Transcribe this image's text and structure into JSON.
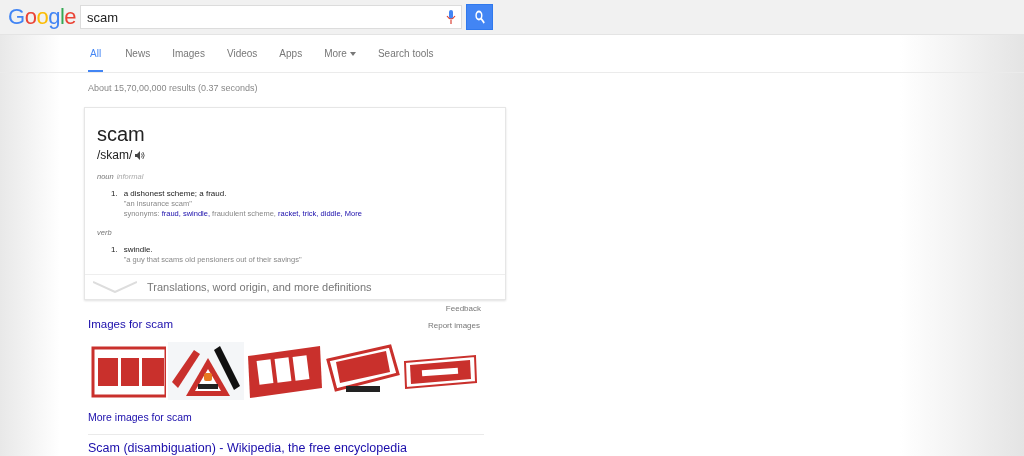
{
  "header": {
    "logo": "Google",
    "query": "scam"
  },
  "tabs": [
    {
      "label": "All",
      "selected": true,
      "kind": "tab"
    },
    {
      "label": "News",
      "selected": false,
      "kind": "tab"
    },
    {
      "label": "Images",
      "selected": false,
      "kind": "tab"
    },
    {
      "label": "Videos",
      "selected": false,
      "kind": "tab"
    },
    {
      "label": "Apps",
      "selected": false,
      "kind": "tab"
    },
    {
      "label": "More",
      "selected": false,
      "kind": "menu"
    },
    {
      "label": "Search tools",
      "selected": false,
      "kind": "tab"
    }
  ],
  "result_stats": "About 15,70,00,000 results (0.37 seconds)",
  "definition": {
    "word": "scam",
    "phonetic": "/skam/",
    "senses": [
      {
        "pos": "noun",
        "register": "informal",
        "entries": [
          {
            "number": "1.",
            "text": "a dishonest scheme; a fraud.",
            "example": "\"an insurance scam\"",
            "synonyms_label": "synonyms:",
            "synonyms": [
              {
                "text": "fraud,",
                "link": true
              },
              {
                "text": "swindle,",
                "link": true
              },
              {
                "text": "fraudulent scheme,",
                "link": false
              },
              {
                "text": "racket,",
                "link": true
              },
              {
                "text": "trick,",
                "link": true
              },
              {
                "text": "diddle,",
                "link": true
              },
              {
                "text": "More",
                "link": true
              }
            ]
          }
        ]
      },
      {
        "pos": "verb",
        "entries": [
          {
            "number": "1.",
            "text": "swindle.",
            "example": "\"a guy that scams old pensioners out of their savings\""
          }
        ]
      }
    ],
    "more_link": "Translations, word origin, and more definitions"
  },
  "feedback": "Feedback",
  "images_section": {
    "title": "Images for scam",
    "report": "Report images",
    "more": "More images for scam"
  },
  "result_title": "Scam (disambiguation) - Wikipedia, the free encyclopedia"
}
